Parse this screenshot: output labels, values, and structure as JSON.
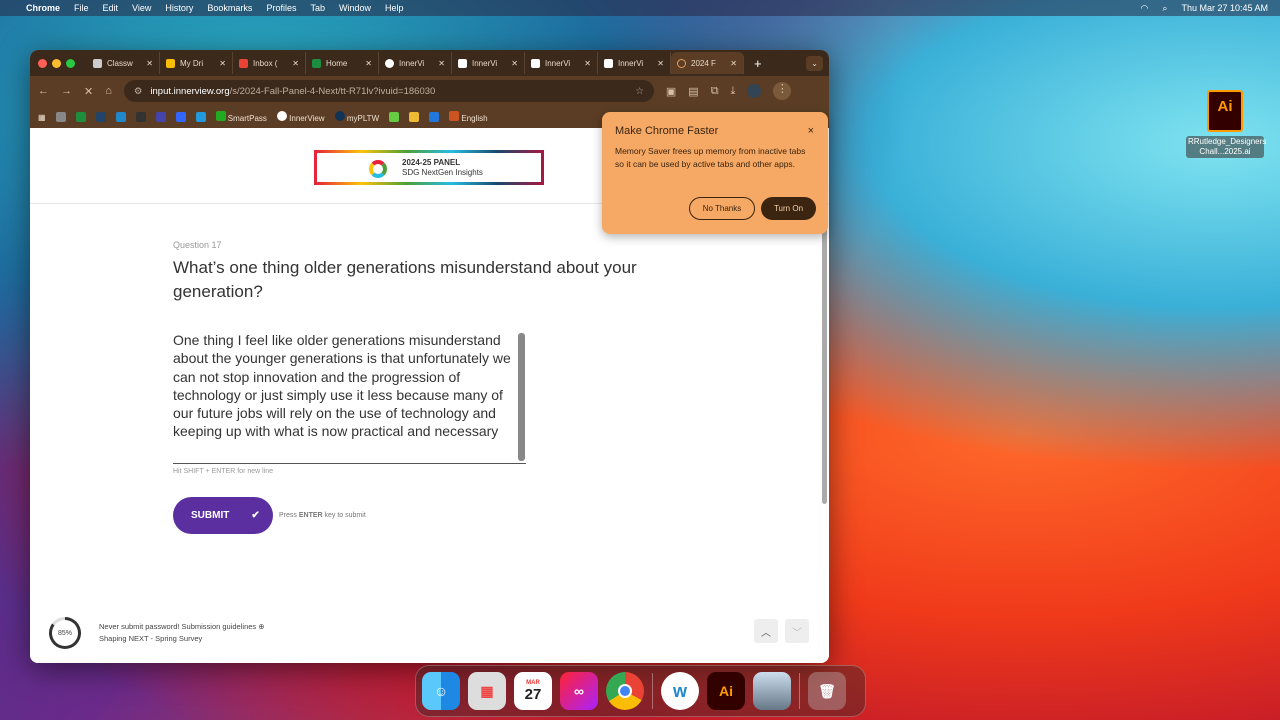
{
  "menubar": {
    "app": "Chrome",
    "items": [
      "File",
      "Edit",
      "View",
      "History",
      "Bookmarks",
      "Profiles",
      "Tab",
      "Window",
      "Help"
    ],
    "datetime": "Thu Mar 27  10:45 AM"
  },
  "tabs": [
    {
      "label": "Classw"
    },
    {
      "label": "My Dri"
    },
    {
      "label": "Inbox ("
    },
    {
      "label": "Home"
    },
    {
      "label": "InnerVi"
    },
    {
      "label": "InnerVi"
    },
    {
      "label": "InnerVi"
    },
    {
      "label": "InnerVi"
    },
    {
      "label": "2024 F"
    }
  ],
  "new_tab": "+",
  "url": {
    "host": "input.innerview.org",
    "path": "/s/2024-Fall-Panel-4-Next/tt-R71lv?ivuid=186030"
  },
  "bookmarks": [
    "SmartPass",
    "InnerView",
    "myPLTW",
    "English"
  ],
  "banner": {
    "line1": "2024-25 PANEL",
    "line2": "SDG NextGen Insights"
  },
  "question": {
    "number": "Question 17",
    "text": "What’s one thing older generations misunderstand about your generation?"
  },
  "answer": "One thing I feel like older generations misunderstand about the younger generations is that unfortunately we can not stop innovation and the progression of technology or just simply use it less because many of our future jobs will rely on the use of technology and keeping up with what is now practical  and necessary",
  "hint": "Hit SHIFT + ENTER for new line",
  "submit": {
    "label": "SUBMIT",
    "check": "✔",
    "press_pre": "Press ",
    "press_key": "ENTER",
    "press_post": " key to submit"
  },
  "footer": {
    "progress_label": "85%",
    "progress": 0.85,
    "guidelines": "Never submit password! Submission guidelines",
    "survey": "Shaping NEXT - Spring Survey"
  },
  "popup": {
    "title": "Make Chrome Faster",
    "body": "Memory Saver frees up memory from inactive tabs so it can be used by active tabs and other apps.",
    "no": "No Thanks",
    "yes": "Turn On",
    "close": "×"
  },
  "desktop_file": {
    "icon": "Ai",
    "name": "RRutledge_Designers Chall...2025.ai"
  },
  "dock": {
    "calendar_month": "MAR",
    "calendar_day": "27"
  }
}
